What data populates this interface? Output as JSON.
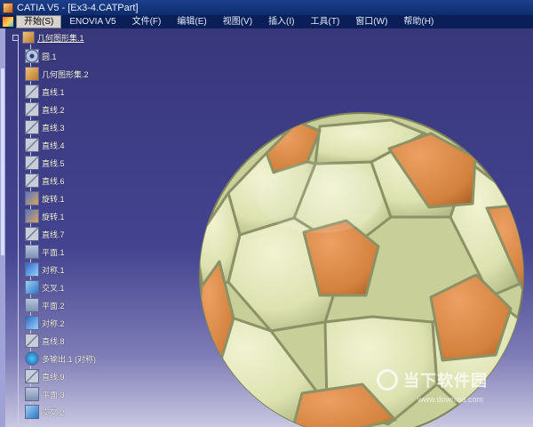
{
  "window": {
    "title": "CATIA V5 - [Ex3-4.CATPart]"
  },
  "menu": {
    "items": [
      {
        "label": "开始(S)",
        "active": true
      },
      {
        "label": "ENOVIA V5"
      },
      {
        "label": "文件(F)"
      },
      {
        "label": "编辑(E)"
      },
      {
        "label": "视图(V)"
      },
      {
        "label": "插入(I)"
      },
      {
        "label": "工具(T)"
      },
      {
        "label": "窗口(W)"
      },
      {
        "label": "帮助(H)"
      }
    ]
  },
  "tree": {
    "root": "几何图形集.1",
    "nodes": [
      {
        "label": "圆.1",
        "icon": "circle-icon"
      },
      {
        "label": "几何图形集.2",
        "icon": "geometrical-set-icon"
      },
      {
        "label": "直线.1",
        "icon": "line-icon"
      },
      {
        "label": "直线.2",
        "icon": "line-icon"
      },
      {
        "label": "直线.3",
        "icon": "line-icon"
      },
      {
        "label": "直线.4",
        "icon": "line-icon"
      },
      {
        "label": "直线.5",
        "icon": "line-icon"
      },
      {
        "label": "直线.6",
        "icon": "line-icon"
      },
      {
        "label": "旋转.1",
        "icon": "rotate-icon"
      },
      {
        "label": "旋转.1",
        "icon": "rotate-icon"
      },
      {
        "label": "直线.7",
        "icon": "line-icon"
      },
      {
        "label": "平面.1",
        "icon": "plane-icon"
      },
      {
        "label": "对称.1",
        "icon": "symmetry-icon"
      },
      {
        "label": "交叉.1",
        "icon": "intersection-icon"
      },
      {
        "label": "平面.2",
        "icon": "plane-icon"
      },
      {
        "label": "对称.2",
        "icon": "symmetry-icon"
      },
      {
        "label": "直线.8",
        "icon": "line-icon"
      },
      {
        "label": "多输出.1 (对称)",
        "icon": "multi-output-icon"
      },
      {
        "label": "直线.9",
        "icon": "line-icon"
      },
      {
        "label": "平面.3",
        "icon": "plane-icon"
      },
      {
        "label": "交叉.2",
        "icon": "intersection-icon"
      }
    ]
  },
  "watermark": {
    "text": "当下软件园",
    "url": "www.downxia.com"
  },
  "colors": {
    "ball_light": "#e4e7b9",
    "ball_orange": "#d88a45",
    "background": "#3e3d84"
  }
}
